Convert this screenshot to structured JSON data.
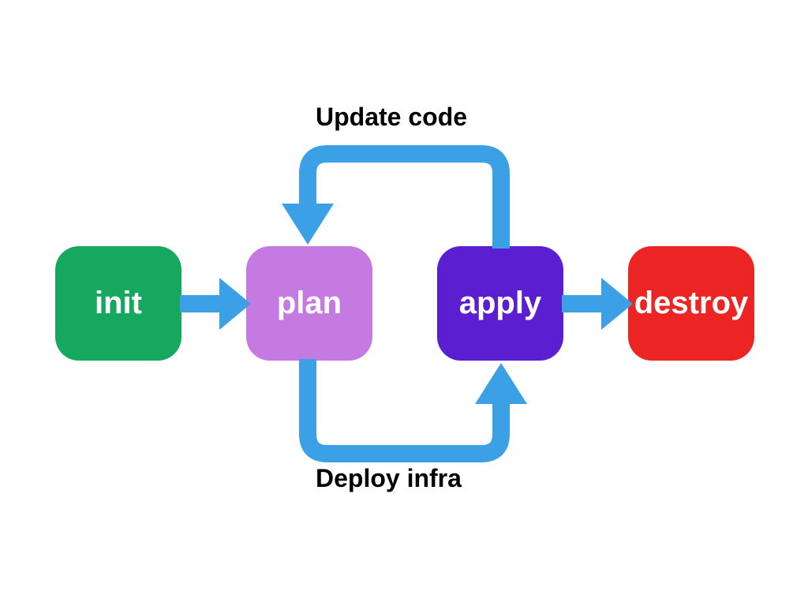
{
  "nodes": {
    "init": {
      "label": "init",
      "color": "#16a85f"
    },
    "plan": {
      "label": "plan",
      "color": "#c57ae2"
    },
    "apply": {
      "label": "apply",
      "color": "#5b1fd1"
    },
    "destroy": {
      "label": "destroy",
      "color": "#ed2424"
    }
  },
  "labels": {
    "top": "Update code",
    "bottom": "Deploy infra"
  },
  "arrow_color": "#3ba0e6"
}
